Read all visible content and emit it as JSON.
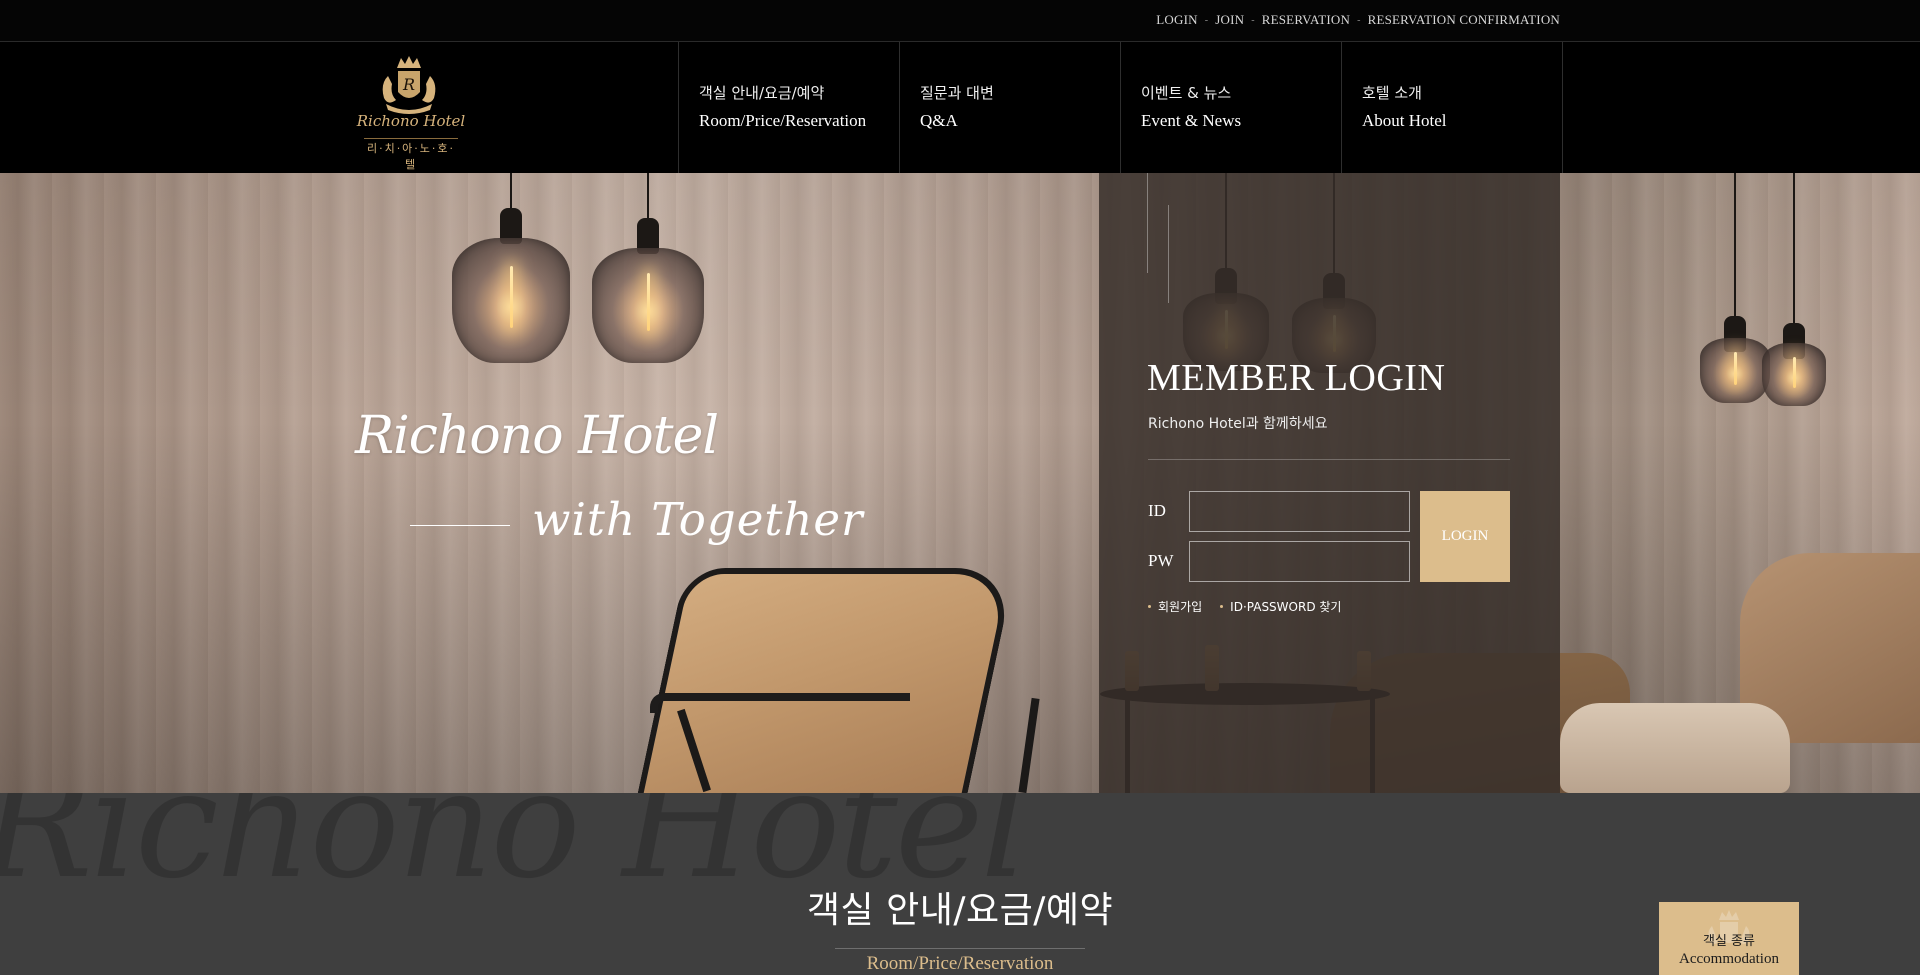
{
  "util_nav": {
    "login": "LOGIN",
    "join": "JOIN",
    "reservation": "RESERVATION",
    "reservation_confirmation": "RESERVATION CONFIRMATION",
    "separator": "-"
  },
  "logo": {
    "brand": "Richono Hotel",
    "brand_ko": "리·치·아·노·호·텔"
  },
  "gnb": [
    {
      "ko": "객실 안내/요금/예약",
      "en": "Room/Price/Reservation"
    },
    {
      "ko": "질문과 대변",
      "en": "Q&A"
    },
    {
      "ko": "이벤트 & 뉴스",
      "en": "Event & News"
    },
    {
      "ko": "호텔 소개",
      "en": "About Hotel"
    }
  ],
  "hero": {
    "slogan_main": "Richono Hotel",
    "slogan_sub": "with Together"
  },
  "login": {
    "title": "MEMBER LOGIN",
    "subtitle": "Richono Hotel과 함께하세요",
    "id_label": "ID",
    "pw_label": "PW",
    "id_value": "",
    "pw_value": "",
    "button": "LOGIN",
    "link_join": "회원가입",
    "link_find": "ID·PASSWORD 찾기"
  },
  "section": {
    "bg_text": "Richono Hotel",
    "title": "객실 안내/요금/예약",
    "subtitle": "Room/Price/Reservation",
    "badge_ko": "객실 종류",
    "badge_en": "Accommodation"
  },
  "colors": {
    "accent": "#dcbd8c",
    "logo_gold": "#d6b37c",
    "bar_bg": "#000000",
    "section_bg": "#3f3f3f"
  }
}
